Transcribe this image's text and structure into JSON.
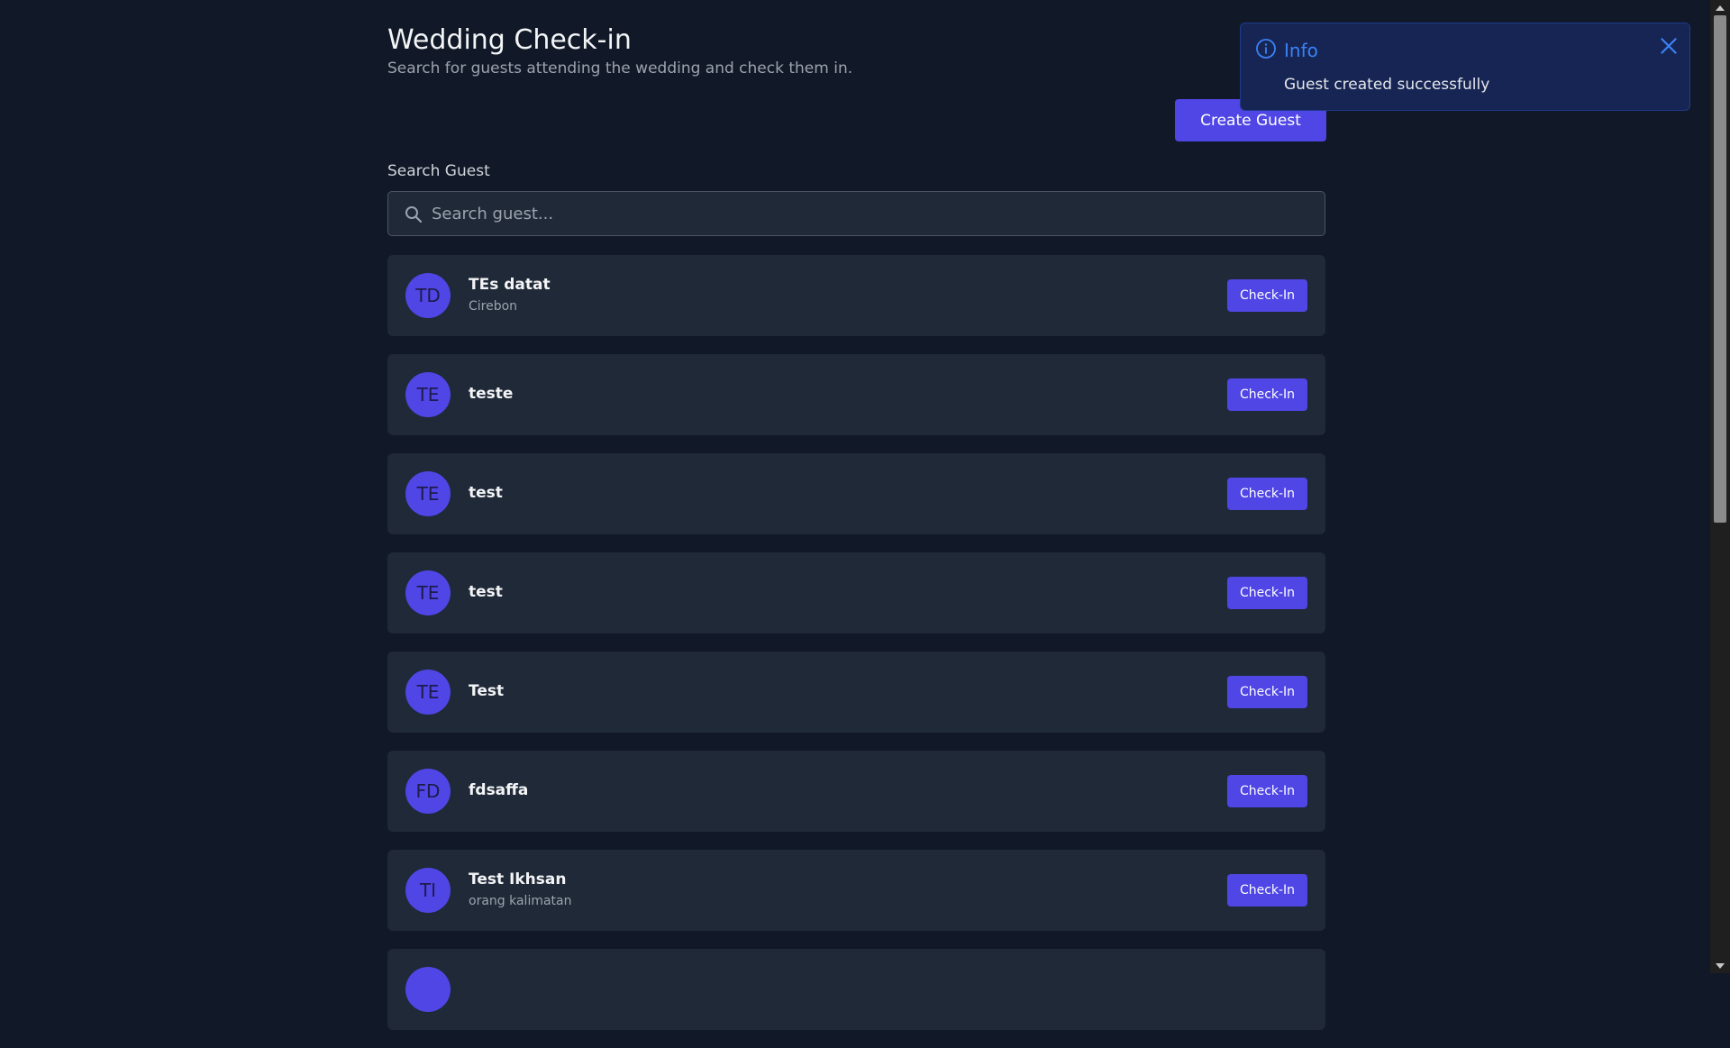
{
  "header": {
    "title": "Wedding Check-in",
    "subtitle": "Search for guests attending the wedding and check them in.",
    "create_button": "Create Guest"
  },
  "search": {
    "label": "Search Guest",
    "placeholder": "Search guest...",
    "value": ""
  },
  "guests": [
    {
      "initials": "TD",
      "name": "TEs datat",
      "city": "Cirebon",
      "action": "Check-In"
    },
    {
      "initials": "TE",
      "name": "teste",
      "city": "",
      "action": "Check-In"
    },
    {
      "initials": "TE",
      "name": "test",
      "city": "",
      "action": "Check-In"
    },
    {
      "initials": "TE",
      "name": "test",
      "city": "",
      "action": "Check-In"
    },
    {
      "initials": "TE",
      "name": "Test",
      "city": "",
      "action": "Check-In"
    },
    {
      "initials": "FD",
      "name": "fdsaffa",
      "city": "",
      "action": "Check-In"
    },
    {
      "initials": "TI",
      "name": "Test Ikhsan",
      "city": "orang kalimatan",
      "action": "Check-In"
    },
    {
      "initials": "",
      "name": "",
      "city": "",
      "action": ""
    }
  ],
  "toast": {
    "title": "Info",
    "message": "Guest created successfully",
    "icon": "info-icon"
  },
  "colors": {
    "background": "#111827",
    "card": "#1f2937",
    "accent": "#4f46e5",
    "toast_bg": "#172554",
    "toast_title": "#3b82f6"
  }
}
